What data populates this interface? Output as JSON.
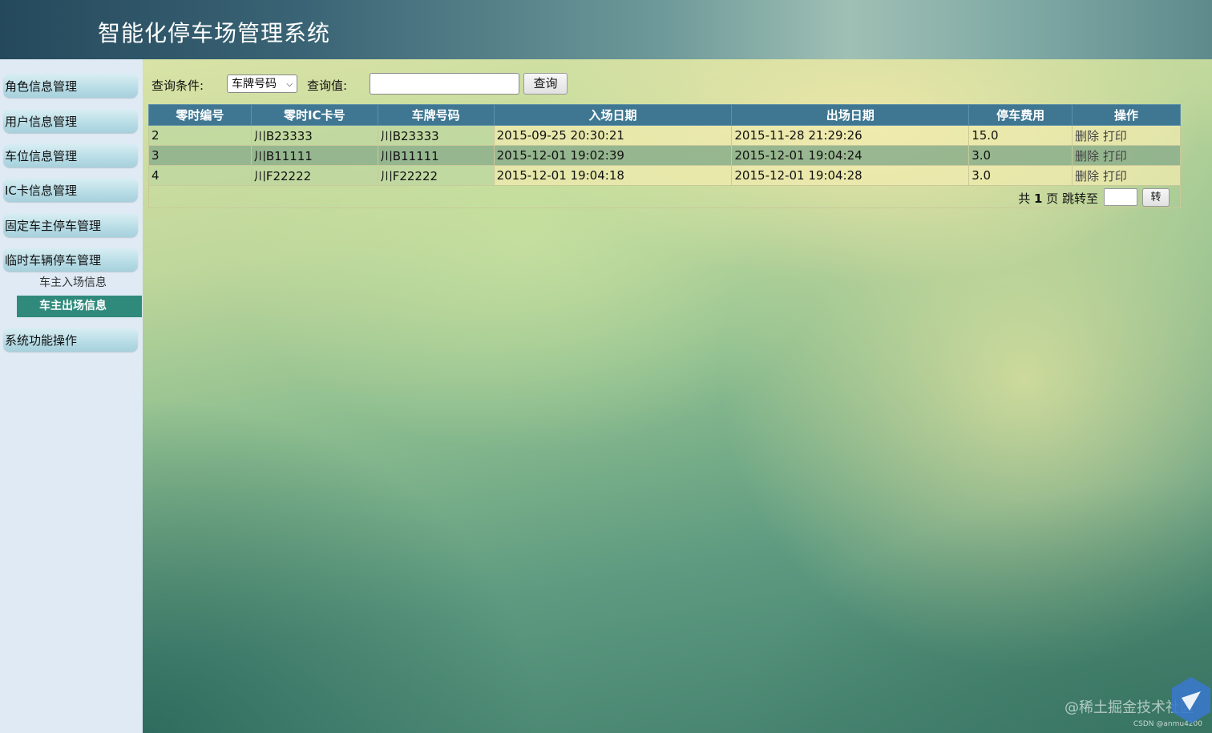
{
  "app": {
    "title": "智能化停车场管理系统"
  },
  "sidebar": {
    "items": [
      {
        "label": "角色信息管理"
      },
      {
        "label": "用户信息管理"
      },
      {
        "label": "车位信息管理"
      },
      {
        "label": "IC卡信息管理"
      },
      {
        "label": "固定车主停车管理"
      },
      {
        "label": "临时车辆停车管理"
      },
      {
        "label": "系统功能操作"
      }
    ],
    "submenu": [
      {
        "label": "车主入场信息",
        "active": false
      },
      {
        "label": "车主出场信息",
        "active": true
      }
    ]
  },
  "search": {
    "condition_label": "查询条件:",
    "condition_selected": "车牌号码",
    "value_label": "查询值:",
    "value": "",
    "button_label": "查询"
  },
  "table": {
    "columns": [
      "零时编号",
      "零时IC卡号",
      "车牌号码",
      "入场日期",
      "出场日期",
      "停车费用",
      "操作"
    ],
    "rows": [
      {
        "id": "2",
        "ic": "川B23333",
        "plate": "川B23333",
        "in": "2015-09-25 20:30:21",
        "out": "2015-11-28 21:29:26",
        "fee": "15.0"
      },
      {
        "id": "3",
        "ic": "川B11111",
        "plate": "川B11111",
        "in": "2015-12-01 19:02:39",
        "out": "2015-12-01 19:04:24",
        "fee": "3.0"
      },
      {
        "id": "4",
        "ic": "川F22222",
        "plate": "川F22222",
        "in": "2015-12-01 19:04:18",
        "out": "2015-12-01 19:04:28",
        "fee": "3.0"
      }
    ],
    "actions": {
      "delete": "删除",
      "print": "打印"
    }
  },
  "pager": {
    "prefix": "共",
    "total_pages": "1",
    "suffix": "页 跳转至",
    "jump_value": "",
    "go_label": "转"
  },
  "watermark": {
    "main": "@稀土掘金技术社区",
    "small": "CSDN @anmu4200"
  },
  "colors": {
    "header_bg": "#25495c",
    "table_header": "#3f7792",
    "active_menu": "#2f8a7c",
    "sidebar_bg": "#dfeaf5"
  }
}
